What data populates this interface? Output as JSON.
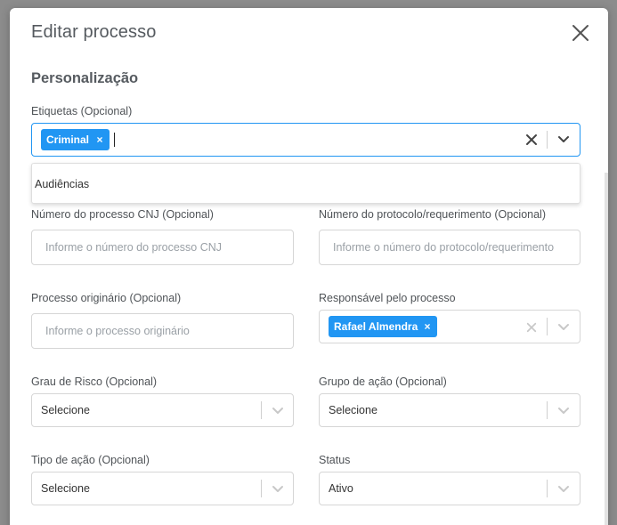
{
  "modal": {
    "title": "Editar processo",
    "section_title": "Personalização"
  },
  "tags": {
    "label": "Etiquetas (Opcional)",
    "chips": [
      "Criminal"
    ],
    "remove_glyph": "×",
    "menu_options": [
      "Audiências"
    ]
  },
  "cnj": {
    "label": "Número do processo CNJ (Opcional)",
    "placeholder": "Informe o número do processo CNJ"
  },
  "protocol": {
    "label": "Número do protocolo/requerimento (Opcional)",
    "placeholder": "Informe o número do protocolo/requerimento"
  },
  "origin": {
    "label": "Processo originário (Opcional)",
    "placeholder": "Informe o processo originário"
  },
  "responsible": {
    "label": "Responsável pelo processo",
    "chips": [
      "Rafael Almendra"
    ]
  },
  "risk": {
    "label": "Grau de Risco (Opcional)",
    "value": "Selecione"
  },
  "action_group": {
    "label": "Grupo de ação (Opcional)",
    "value": "Selecione"
  },
  "action_type": {
    "label": "Tipo de ação (Opcional)",
    "value": "Selecione"
  },
  "status": {
    "label": "Status",
    "value": "Ativo"
  },
  "colors": {
    "accent": "#2196f3",
    "backdrop": "#8c8c8c"
  },
  "icons": {
    "close": "close-icon",
    "clear": "clear-icon",
    "chevron": "chevron-down-icon"
  }
}
